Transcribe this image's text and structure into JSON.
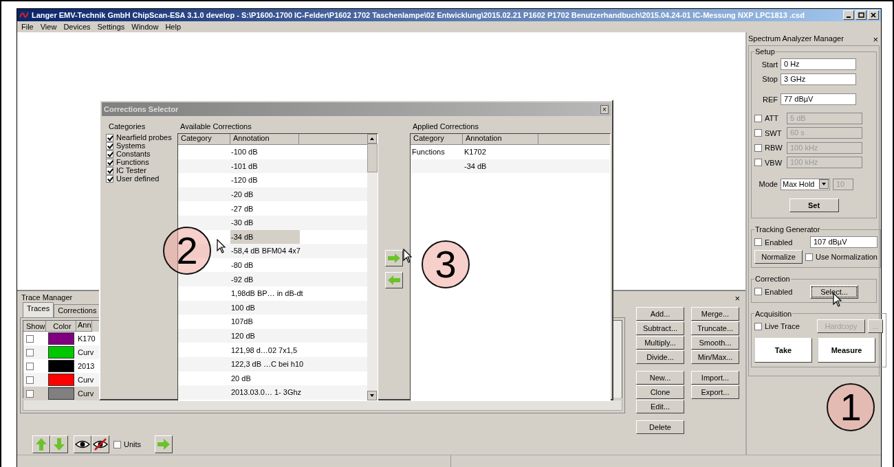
{
  "window": {
    "title": "Langer EMV-Technik GmbH ChipScan-ESA 3.1.0 develop  -  S:\\P1600-1700 IC-Felder\\P1602 1702 Taschenlampe\\02 Entwicklung\\2015.02.21 P1602 P1702 Benutzerhandbuch\\2015.04.24-01 IC-Messung  NXP LPC1813 .csd"
  },
  "menu": [
    "File",
    "View",
    "Devices",
    "Settings",
    "Window",
    "Help"
  ],
  "trace_manager": {
    "title": "Trace Manager",
    "close": "×",
    "tabs": [
      {
        "label": "Traces",
        "selected": true
      },
      {
        "label": "Corrections",
        "selected": false
      }
    ],
    "columns": [
      "Show",
      "Color",
      "Ann"
    ],
    "rows": [
      {
        "show": false,
        "color": "#800080",
        "annotation": "K170",
        "selected": false
      },
      {
        "show": false,
        "color": "#00c800",
        "annotation": "Curv",
        "selected": false
      },
      {
        "show": false,
        "color": "#000000",
        "annotation": "2013",
        "selected": false
      },
      {
        "show": false,
        "color": "#ff0000",
        "annotation": "Curv",
        "selected": false
      },
      {
        "show": false,
        "color": "#808080",
        "annotation": "Curv",
        "selected": true
      }
    ],
    "button_groups": [
      [
        "Add...",
        "Subtract...",
        "Multiply...",
        "Divide..."
      ],
      [
        "Merge...",
        "Truncate...",
        "Smooth...",
        "Min/Max..."
      ],
      [
        "New...",
        "Clone",
        "Edit..."
      ],
      [
        "Import...",
        "Export..."
      ],
      [
        "Delete"
      ]
    ],
    "units": {
      "label": "Units",
      "checked": false
    }
  },
  "spectrum_analyzer": {
    "title": "Spectrum Analyzer Manager",
    "close": "×",
    "setup": {
      "legend": "Setup",
      "fields": [
        {
          "kind": "plain",
          "label": "Start",
          "value": "0 Hz"
        },
        {
          "kind": "plain",
          "label": "Stop",
          "value": "3 GHz"
        },
        {
          "kind": "plain",
          "label": "REF",
          "value": "77 dBµV"
        },
        {
          "kind": "optional",
          "label": "ATT",
          "value": "5 dB",
          "checked": false
        },
        {
          "kind": "optional",
          "label": "SWT",
          "value": "60 s",
          "checked": false
        },
        {
          "kind": "optional",
          "label": "RBW",
          "value": "100 kHz",
          "checked": false
        },
        {
          "kind": "optional",
          "label": "VBW",
          "value": "100 kHz",
          "checked": false
        }
      ],
      "mode": {
        "label": "Mode",
        "value": "Max Hold",
        "count": "10"
      },
      "set": "Set"
    },
    "tracking": {
      "legend": "Tracking Generator",
      "enabled": {
        "label": "Enabled",
        "checked": false
      },
      "value": "107 dBµV",
      "normalize": "Normalize",
      "use_normalization": {
        "label": "Use Normalization",
        "checked": false
      }
    },
    "correction": {
      "legend": "Correction",
      "enabled": {
        "label": "Enabled",
        "checked": false
      },
      "select": "Select...",
      "callout": "1"
    },
    "acquisition": {
      "legend": "Acquisition",
      "live_trace": {
        "label": "Live Trace",
        "checked": false
      },
      "hardcopy": "Hardcopy",
      "more": "...",
      "take": "Take",
      "measure": "Measure"
    }
  },
  "dialog": {
    "title": "Corrections Selector",
    "close": "×",
    "categories": {
      "label": "Categories",
      "items": [
        {
          "label": "Nearfield probes",
          "checked": true
        },
        {
          "label": "Systems",
          "checked": true
        },
        {
          "label": "Constants",
          "checked": true
        },
        {
          "label": "Functions",
          "checked": true
        },
        {
          "label": "IC Tester",
          "checked": true
        },
        {
          "label": "User defined",
          "checked": true
        }
      ]
    },
    "available": {
      "label": "Available Corrections",
      "columns": [
        "Category",
        "Annotation"
      ],
      "callout": "2",
      "rows": [
        {
          "annotation": "-100 dB",
          "selected": false
        },
        {
          "annotation": "-101 dB",
          "selected": false
        },
        {
          "annotation": "-120 dB",
          "selected": false
        },
        {
          "annotation": "-20 dB",
          "selected": false
        },
        {
          "annotation": "-27 dB",
          "selected": false
        },
        {
          "annotation": "-30 dB",
          "selected": false
        },
        {
          "annotation": "-34 dB",
          "selected": true
        },
        {
          "annotation": "-58,4 dB BFM04 4x7",
          "selected": false
        },
        {
          "annotation": "-80 dB",
          "selected": false
        },
        {
          "annotation": "-92 dB",
          "selected": false
        },
        {
          "annotation": "1,98dB BP… in dB-dt",
          "selected": false
        },
        {
          "annotation": "100 dB",
          "selected": false
        },
        {
          "annotation": "107dB",
          "selected": false
        },
        {
          "annotation": "120 dB",
          "selected": false
        },
        {
          "annotation": "121,98 d…02 7x1,5",
          "selected": false
        },
        {
          "annotation": "122,3 dB …C bei h10",
          "selected": false
        },
        {
          "annotation": "20 dB",
          "selected": false
        },
        {
          "annotation": "2013.03.0… 1- 3Ghz",
          "selected": false
        }
      ]
    },
    "move_callout": "3",
    "applied": {
      "label": "Applied Corrections",
      "columns": [
        "Category",
        "Annotation"
      ],
      "rows": [
        {
          "category": "Functions",
          "annotation": "K1702"
        },
        {
          "annotation": "-34 dB"
        }
      ]
    }
  }
}
